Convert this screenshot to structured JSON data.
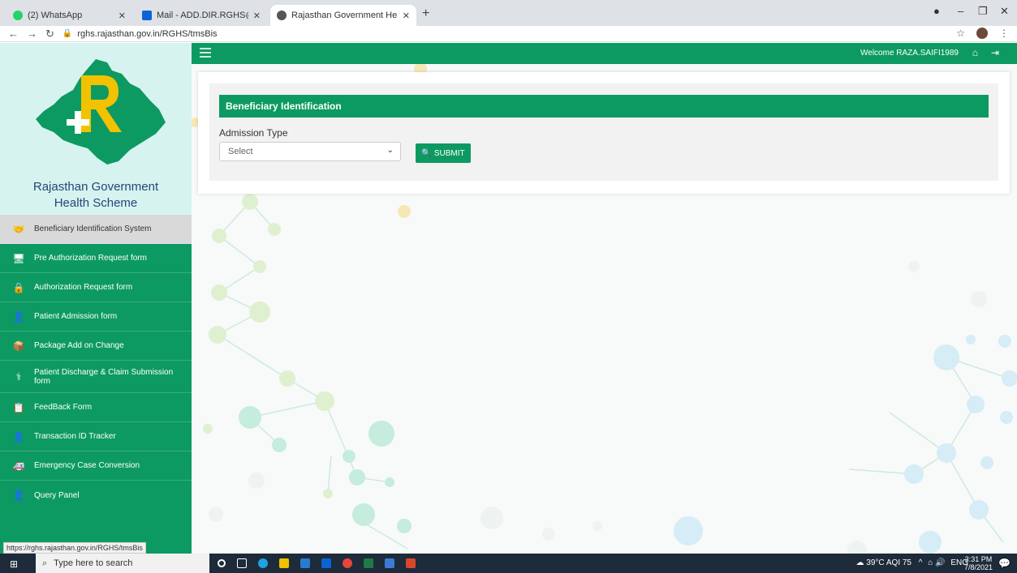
{
  "browser": {
    "tabs": [
      {
        "label": "(2) WhatsApp",
        "favicon_color": "#25d366"
      },
      {
        "label": "Mail - ADD.DIR.RGHS@RAJASTH",
        "favicon_color": "#0a64d6"
      },
      {
        "label": "Rajasthan Government Health Sc",
        "favicon_color": "#555555"
      }
    ],
    "url": "rghs.rajasthan.gov.in/RGHS/tmsBis",
    "status_url": "https://rghs.rajasthan.gov.in/RGHS/tmsBis"
  },
  "sidebar": {
    "title_line1": "Rajasthan Government",
    "title_line2": "Health Scheme",
    "items": [
      {
        "label": "Beneficiary Identification System",
        "icon": "handshake-icon",
        "glyph": "🤝"
      },
      {
        "label": "Pre Authorization Request form",
        "icon": "monitor-icon",
        "glyph": "🖥"
      },
      {
        "label": "Authorization Request form",
        "icon": "lock-icon",
        "glyph": "🔒"
      },
      {
        "label": "Patient Admission form",
        "icon": "patient-icon",
        "glyph": "👤"
      },
      {
        "label": "Package Add on Change",
        "icon": "package-icon",
        "glyph": "📦"
      },
      {
        "label": "Patient Discharge & Claim Submission form",
        "icon": "discharge-icon",
        "glyph": "⚕"
      },
      {
        "label": "FeedBack Form",
        "icon": "feedback-icon",
        "glyph": "📋"
      },
      {
        "label": "Transaction ID Tracker",
        "icon": "user-icon",
        "glyph": "👤"
      },
      {
        "label": "Emergency Case Conversion",
        "icon": "ambulance-icon",
        "glyph": "🚑"
      },
      {
        "label": "Query Panel",
        "icon": "user-icon",
        "glyph": "👤"
      }
    ]
  },
  "topbar": {
    "welcome": "Welcome RAZA.SAIFI1989"
  },
  "form": {
    "header": "Beneficiary Identification",
    "field_label": "Admission Type",
    "select_value": "Select",
    "submit_label": "SUBMIT"
  },
  "taskbar": {
    "search_placeholder": "Type here to search",
    "weather": "39°C AQI 75",
    "language": "ENG",
    "time": "3:31 PM",
    "date": "7/8/2021"
  },
  "colors": {
    "brand_green": "#0d9a62",
    "logo_bg": "#d6f3ef",
    "logo_text": "#24457a"
  }
}
